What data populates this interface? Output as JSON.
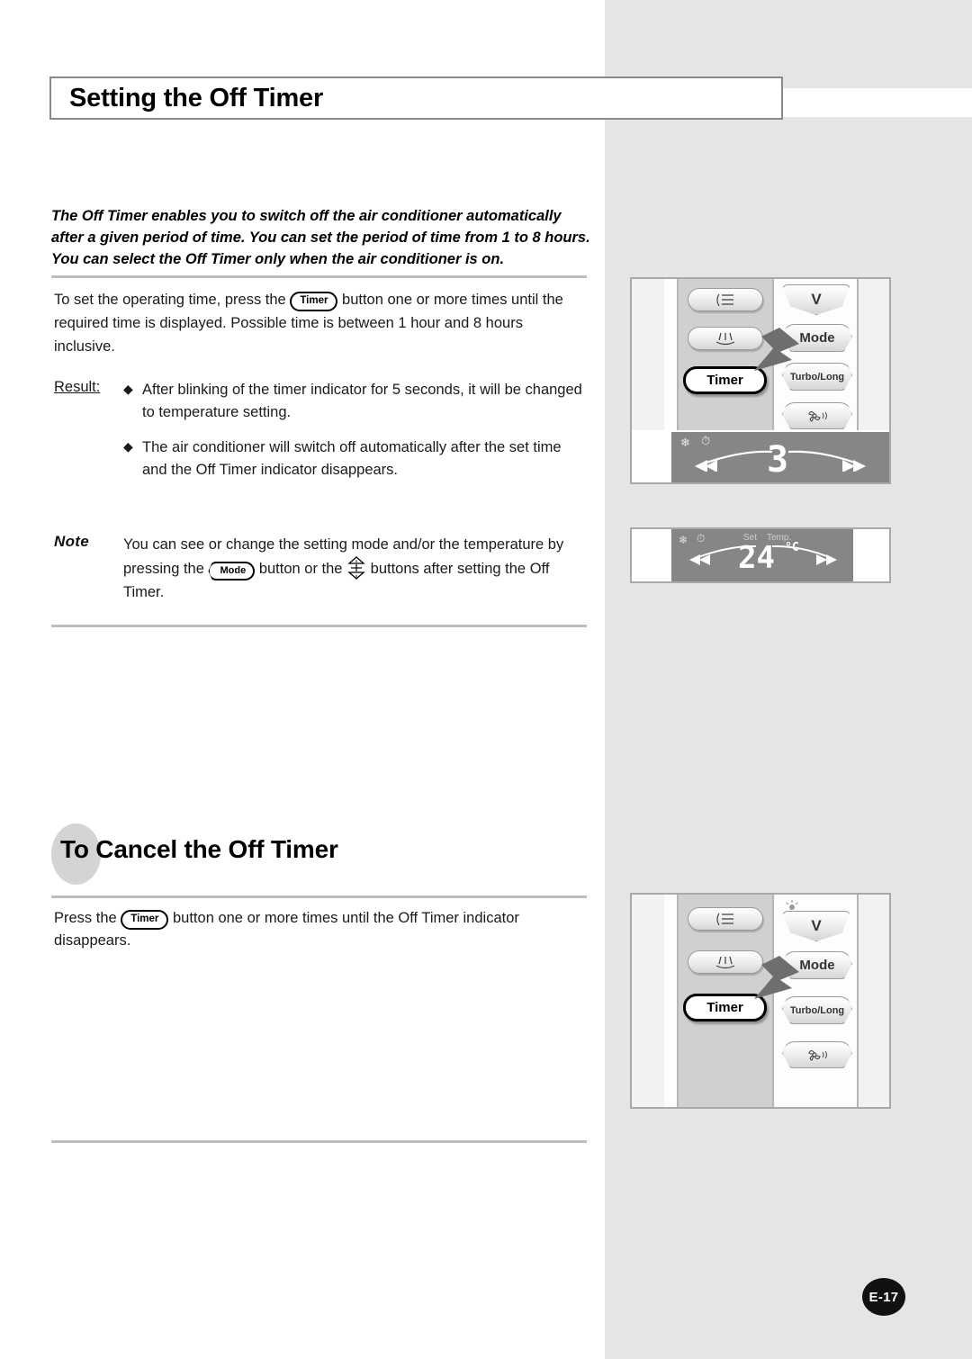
{
  "document": {
    "title": "Setting the Off Timer",
    "page_number": "E-17"
  },
  "intro": {
    "text": "The Off Timer enables you to switch off the air conditioner automatically after a given period of time. You can set the period of time from 1 to 8 hours. You can select the Off Timer only when the air conditioner is on."
  },
  "instructions": {
    "para_before_key": "To set the operating time, press the",
    "key_label": "Timer",
    "para_after_key": "button one or more times until the required time is displayed. Possible time is between 1 hour and 8 hours inclusive.",
    "result_label": "Result:",
    "result_items": [
      "After blinking of the timer indicator for 5 seconds, it will be changed to temperature setting.",
      "The air conditioner will switch off automatically after the set time and the Off Timer indicator disappears."
    ],
    "bullet_glyph": "◆"
  },
  "note": {
    "badge": "Note",
    "text_part_1": "You can see or change the setting mode and/or the temperature by pressing the",
    "mode_key": "Mode",
    "text_part_2": "button or the",
    "text_part_3": "buttons after setting the",
    "text_part_4": "Off Timer."
  },
  "cancel_section": {
    "heading_prefix": "To",
    "heading": "To Cancel the Off Timer",
    "para_before_key": "Press the",
    "key_label": "Timer",
    "para_after_key": "button one or more times until the Off Timer indicator disappears."
  },
  "remote_top": {
    "buttons": [
      {
        "name": "airflow-wide-button",
        "label": ""
      },
      {
        "name": "airflow-narrow-button",
        "label": ""
      },
      {
        "name": "timer-button",
        "label": "Timer"
      },
      {
        "name": "power-button",
        "label": "V"
      },
      {
        "name": "mode-button",
        "label": "Mode"
      },
      {
        "name": "turbo-long-button",
        "label": "Turbo/Long"
      },
      {
        "name": "fan-speed-button",
        "label": ""
      }
    ],
    "display": {
      "value": "3",
      "snowflake_icon": "❄",
      "timer_icon": "⏱",
      "left_arrows": "«",
      "right_arrows": "»"
    }
  },
  "display_mid": {
    "set_label": "Set",
    "temp_label": "Temp.",
    "value": "24",
    "unit": "°C",
    "snowflake_icon": "❄",
    "timer_icon": "⏱",
    "left_arrows": "«",
    "right_arrows": "»"
  },
  "remote_bottom": {
    "buttons": [
      {
        "name": "airflow-wide-button",
        "label": ""
      },
      {
        "name": "airflow-narrow-button",
        "label": ""
      },
      {
        "name": "timer-button",
        "label": "Timer"
      },
      {
        "name": "power-button",
        "label": "V"
      },
      {
        "name": "mode-button",
        "label": "Mode"
      },
      {
        "name": "turbo-long-button",
        "label": "Turbo/Long"
      },
      {
        "name": "fan-speed-button",
        "label": ""
      }
    ]
  },
  "colors": {
    "page_sidebar": "#e5e5e5",
    "rule": "#bdbdbd",
    "lcd_background": "#868686",
    "title_border": "#8a8a8a",
    "page_num_bg": "#111111"
  }
}
